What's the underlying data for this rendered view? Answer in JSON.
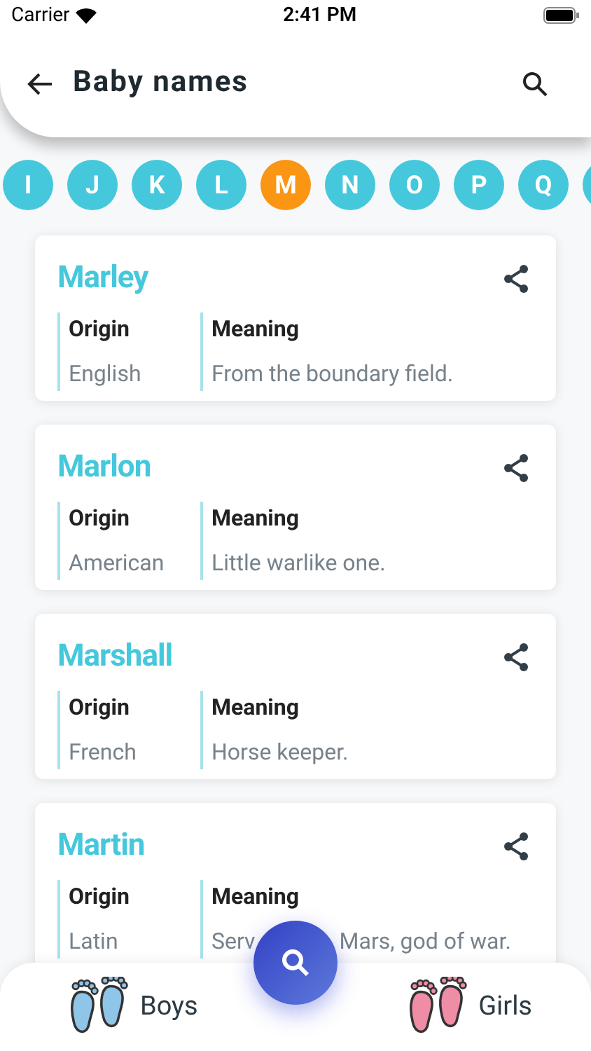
{
  "status_bar": {
    "carrier": "Carrier",
    "time": "2:41 PM"
  },
  "header": {
    "title": "Baby names"
  },
  "letters": [
    {
      "letter": "I",
      "selected": false
    },
    {
      "letter": "J",
      "selected": false
    },
    {
      "letter": "K",
      "selected": false
    },
    {
      "letter": "L",
      "selected": false
    },
    {
      "letter": "M",
      "selected": true
    },
    {
      "letter": "N",
      "selected": false
    },
    {
      "letter": "O",
      "selected": false
    },
    {
      "letter": "P",
      "selected": false
    },
    {
      "letter": "Q",
      "selected": false
    }
  ],
  "names": [
    {
      "name": "Marley",
      "origin_label": "Origin",
      "origin": "English",
      "meaning_label": "Meaning",
      "meaning_parts": [
        "From the boundary field."
      ]
    },
    {
      "name": "Marlon",
      "origin_label": "Origin",
      "origin": "American",
      "meaning_label": "Meaning",
      "meaning_parts": [
        "Little warlike one."
      ]
    },
    {
      "name": "Marshall",
      "origin_label": "Origin",
      "origin": "French",
      "meaning_label": "Meaning",
      "meaning_parts": [
        "Horse keeper."
      ]
    },
    {
      "name": "Martin",
      "origin_label": "Origin",
      "origin": "Latin",
      "meaning_label": "Meaning",
      "meaning_parts": [
        "Serv",
        "Mars, god of war."
      ]
    }
  ],
  "bottom_nav": [
    {
      "label": "Boys",
      "kind": "boys"
    },
    {
      "label": "Girls",
      "kind": "girls"
    }
  ]
}
